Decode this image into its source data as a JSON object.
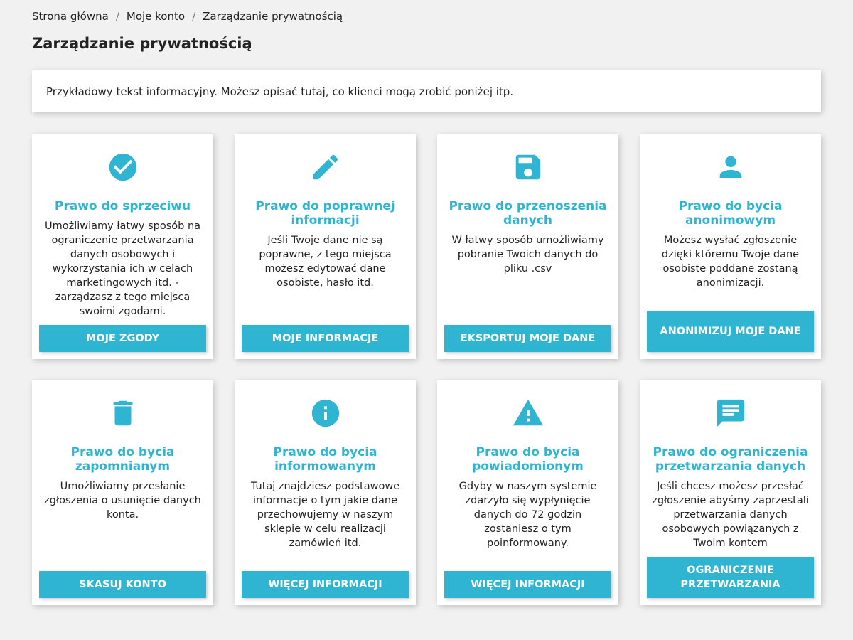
{
  "breadcrumb": {
    "home": "Strona główna",
    "account": "Moje konto",
    "current": "Zarządzanie prywatnością",
    "separator": "/"
  },
  "page": {
    "title": "Zarządzanie prywatnością",
    "info_text": "Przykładowy tekst informacyjny. Możesz opisać tutaj, co klienci mogą zrobić poniżej itp."
  },
  "colors": {
    "accent": "#2fb5d2",
    "background": "#f1f1f1",
    "text": "#232323"
  },
  "cards": [
    {
      "icon": "check-circle-icon",
      "title": "Prawo do sprzeciwu",
      "description": "Umożliwiamy łatwy sposób na ograniczenie przetwarzania danych osobowych i wykorzystania ich w celach marketingowych itd. - zarządzasz z tego miejsca swoimi zgodami.",
      "button": "Moje zgody"
    },
    {
      "icon": "pencil-icon",
      "title": "Prawo do poprawnej informacji",
      "description": "Jeśli Twoje dane nie są poprawne, z tego miejsca możesz edytować dane osobiste, hasło itd.",
      "button": "Moje informacje"
    },
    {
      "icon": "floppy-disk-icon",
      "title": "Prawo do przenoszenia danych",
      "description": "W łatwy sposób umożliwiamy pobranie Twoich danych do pliku .csv",
      "button": "Eksportuj moje dane"
    },
    {
      "icon": "person-icon",
      "title": "Prawo do bycia anonimowym",
      "description": "Możesz wysłać zgłoszenie dzięki któremu Twoje dane osobiste poddane zostaną anonimizacji.",
      "button": "Anonimizuj moje dane"
    },
    {
      "icon": "trash-icon",
      "title": "Prawo do bycia zapomnianym",
      "description": "Umożliwiamy przesłanie zgłoszenia o usunięcie danych konta.",
      "button": "Skasuj konto"
    },
    {
      "icon": "info-circle-icon",
      "title": "Prawo do bycia informowanym",
      "description": "Tutaj znajdziesz podstawowe informacje o tym jakie dane przechowujemy w naszym sklepie w celu realizacji zamówień itd.",
      "button": "Więcej informacji"
    },
    {
      "icon": "warning-triangle-icon",
      "title": "Prawo do bycia powiadomionym",
      "description": "Gdyby w naszym systemie zdarzyło się wypłynięcie danych do 72 godzin zostaniesz o tym poinformowany.",
      "button": "Więcej informacji"
    },
    {
      "icon": "chat-bubble-icon",
      "title": "Prawo do ograniczenia przetwarzania danych",
      "description": "Jeśli chcesz możesz przesłać zgłoszenie abyśmy zaprzestali przetwarzania danych osobowych powiązanych z Twoim kontem",
      "button": "Ograniczenie przetwarzania"
    }
  ]
}
